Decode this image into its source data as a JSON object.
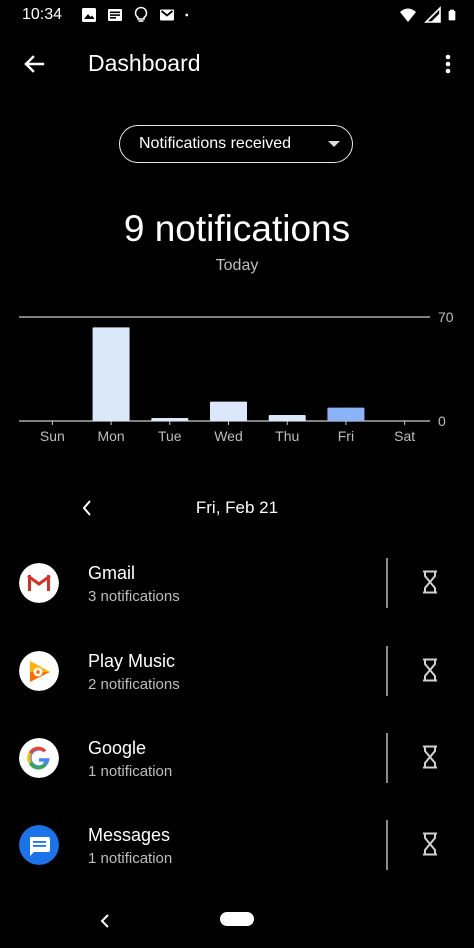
{
  "status_bar": {
    "time": "10:34",
    "left_icons": [
      "image-icon",
      "news-icon",
      "lightbulb-icon",
      "gmail-icon",
      "dot-icon"
    ],
    "right_icons": [
      "wifi-icon",
      "signal-icon",
      "battery-icon"
    ]
  },
  "app_bar": {
    "title": "Dashboard",
    "back_icon": "arrow-back-icon",
    "more_icon": "more-vert-icon"
  },
  "metric_select": {
    "selected": "Notifications received"
  },
  "summary": {
    "headline": "9 notifications",
    "period": "Today"
  },
  "chart_data": {
    "type": "bar",
    "categories": [
      "Sun",
      "Mon",
      "Tue",
      "Wed",
      "Thu",
      "Fri",
      "Sat"
    ],
    "values": [
      0,
      63,
      2,
      13,
      4,
      9,
      0
    ],
    "y_ticks": [
      "70",
      "0"
    ],
    "ylim": [
      0,
      70
    ],
    "highlight_index": 5,
    "colors": {
      "bar": "#dbe8fb",
      "highlight": "#8ab4f8",
      "axis": "#cccccc",
      "label": "#bdbdbd"
    }
  },
  "date_nav": {
    "label": "Fri, Feb 21",
    "prev_icon": "chevron-left-icon"
  },
  "apps": [
    {
      "name": "Gmail",
      "count": "3 notifications",
      "icon": "gmail-app-icon"
    },
    {
      "name": "Play Music",
      "count": "2 notifications",
      "icon": "play-music-app-icon"
    },
    {
      "name": "Google",
      "count": "1 notification",
      "icon": "google-app-icon"
    },
    {
      "name": "Messages",
      "count": "1 notification",
      "icon": "messages-app-icon"
    }
  ],
  "nav_bar": {
    "back_icon": "nav-back-icon",
    "home_icon": "nav-home-pill"
  }
}
